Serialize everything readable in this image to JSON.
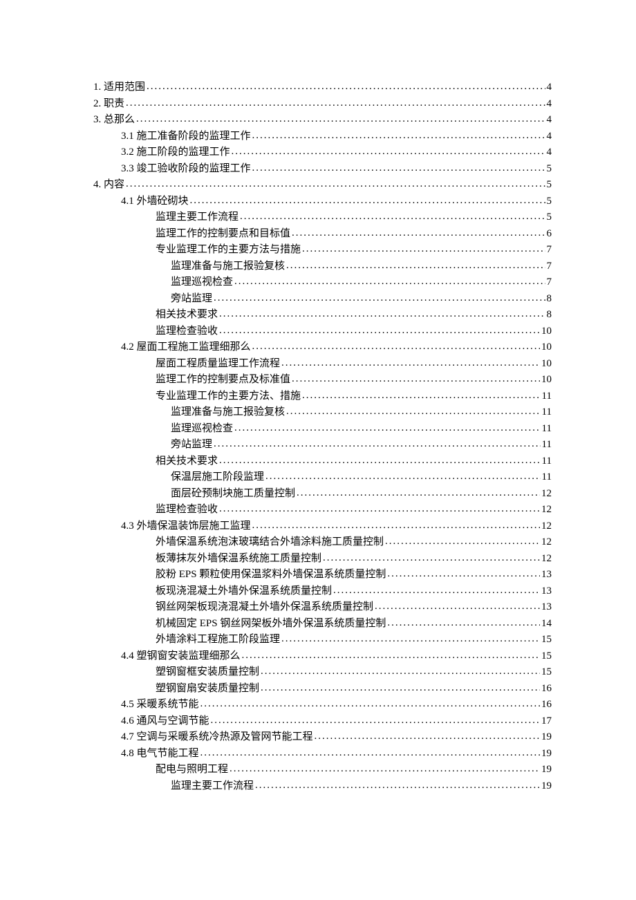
{
  "entries": [
    {
      "level": 0,
      "label": "1. 适用范围",
      "page": "4"
    },
    {
      "level": 0,
      "label": "2. 职责",
      "page": "4"
    },
    {
      "level": 0,
      "label": "3. 总那么",
      "page": "4"
    },
    {
      "level": 1,
      "label": "3.1 施工准备阶段的监理工作",
      "page": "4"
    },
    {
      "level": 1,
      "label": "3.2 施工阶段的监理工作",
      "page": "4"
    },
    {
      "level": 1,
      "label": "3.3 竣工验收阶段的监理工作",
      "page": "5"
    },
    {
      "level": 0,
      "label": "4. 内容",
      "page": "5"
    },
    {
      "level": 1,
      "label": "4.1 外墙砼砌块",
      "page": "5"
    },
    {
      "level": 2,
      "label": "监理主要工作流程",
      "page": "5"
    },
    {
      "level": 2,
      "label": "监理工作的控制要点和目标值",
      "page": "6"
    },
    {
      "level": 2,
      "label": "专业监理工作的主要方法与措施",
      "page": "7"
    },
    {
      "level": 3,
      "label": "监理准备与施工报验复核",
      "page": "7"
    },
    {
      "level": 3,
      "label": "监理巡视检查",
      "page": "7"
    },
    {
      "level": 3,
      "label": "旁站监理",
      "page": "8"
    },
    {
      "level": 2,
      "label": "相关技术要求",
      "page": "8"
    },
    {
      "level": 2,
      "label": "监理检查验收",
      "page": "10"
    },
    {
      "level": 1,
      "label": "4.2 屋面工程施工监理细那么",
      "page": "10"
    },
    {
      "level": 2,
      "label": "屋面工程质量监理工作流程",
      "page": "10"
    },
    {
      "level": 2,
      "label": "监理工作的控制要点及标准值",
      "page": "10"
    },
    {
      "level": 2,
      "label": "专业监理工作的主要方法、措施",
      "page": "11"
    },
    {
      "level": 3,
      "label": "监理准备与施工报验复核",
      "page": "11"
    },
    {
      "level": 3,
      "label": "监理巡视检查",
      "page": "11"
    },
    {
      "level": 3,
      "label": "旁站监理",
      "page": "11"
    },
    {
      "level": 2,
      "label": "相关技术要求",
      "page": "11"
    },
    {
      "level": 3,
      "label": "保温层施工阶段监理",
      "page": "11"
    },
    {
      "level": 3,
      "label": "面层砼预制块施工质量控制",
      "page": "12"
    },
    {
      "level": 2,
      "label": "监理检查验收",
      "page": "12"
    },
    {
      "level": 1,
      "label": "4.3 外墙保温装饰层施工监理",
      "page": "12"
    },
    {
      "level": 2,
      "label": "外墙保温系统泡沫玻璃结合外墙涂料施工质量控制",
      "page": "12"
    },
    {
      "level": 2,
      "label": "板薄抹灰外墙保温系统施工质量控制",
      "page": "12"
    },
    {
      "level": 2,
      "label": "胶粉 EPS 颗粒使用保温浆料外墙保温系统质量控制",
      "page": "13"
    },
    {
      "level": 2,
      "label": "板现浇混凝土外墙外保温系统质量控制",
      "page": "13"
    },
    {
      "level": 2,
      "label": "钢丝网架板现浇混凝土外墙外保温系统质量控制",
      "page": "13"
    },
    {
      "level": 2,
      "label": "机械固定 EPS 钢丝网架板外墙外保温系统质量控制",
      "page": "14"
    },
    {
      "level": 2,
      "label": "外墙涂料工程施工阶段监理",
      "page": "15"
    },
    {
      "level": 1,
      "label": "4.4 塑钢窗安装监理细那么",
      "page": "15"
    },
    {
      "level": 2,
      "label": "塑钢窗框安装质量控制",
      "page": "15"
    },
    {
      "level": 2,
      "label": "塑钢窗扇安装质量控制",
      "page": "16"
    },
    {
      "level": 1,
      "label": "4.5 采暖系统节能",
      "page": "16"
    },
    {
      "level": 1,
      "label": "4.6 通风与空调节能",
      "page": "17"
    },
    {
      "level": 1,
      "label": "4.7 空调与采暖系统冷热源及管网节能工程",
      "page": "19"
    },
    {
      "level": 1,
      "label": "4.8 电气节能工程",
      "page": "19"
    },
    {
      "level": 2,
      "label": "配电与照明工程",
      "page": "19"
    },
    {
      "level": 3,
      "label": "监理主要工作流程",
      "page": "19"
    }
  ]
}
